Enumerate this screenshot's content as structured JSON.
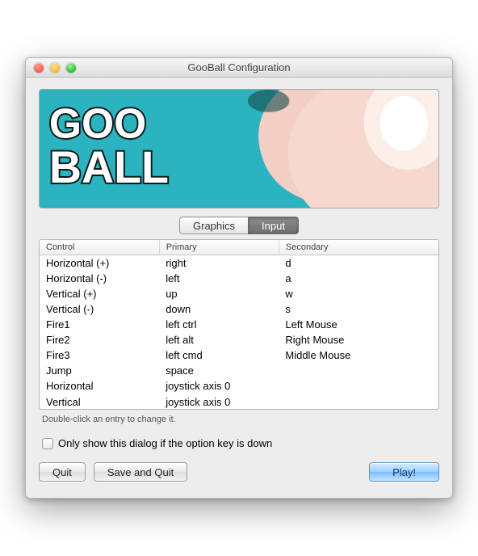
{
  "window": {
    "title": "GooBall Configuration"
  },
  "banner": {
    "logo_text": "GOO BALL"
  },
  "tabs": {
    "graphics": "Graphics",
    "input": "Input",
    "active": "input"
  },
  "table": {
    "headers": {
      "control": "Control",
      "primary": "Primary",
      "secondary": "Secondary"
    },
    "rows": [
      {
        "control": "Horizontal (+)",
        "primary": "right",
        "secondary": "d"
      },
      {
        "control": "Horizontal (-)",
        "primary": "left",
        "secondary": "a"
      },
      {
        "control": "Vertical (+)",
        "primary": "up",
        "secondary": "w"
      },
      {
        "control": "Vertical (-)",
        "primary": "down",
        "secondary": "s"
      },
      {
        "control": "Fire1",
        "primary": "left ctrl",
        "secondary": "Left Mouse"
      },
      {
        "control": "Fire2",
        "primary": "left alt",
        "secondary": "Right Mouse"
      },
      {
        "control": "Fire3",
        "primary": "left cmd",
        "secondary": "Middle Mouse"
      },
      {
        "control": "Jump",
        "primary": "space",
        "secondary": ""
      },
      {
        "control": "Horizontal",
        "primary": "joystick axis 0",
        "secondary": ""
      },
      {
        "control": "Vertical",
        "primary": "joystick axis 0",
        "secondary": ""
      }
    ],
    "hint": "Double-click an entry to change it."
  },
  "checkbox": {
    "label": "Only show this dialog if the option key is down",
    "checked": false
  },
  "buttons": {
    "quit": "Quit",
    "save_quit": "Save and Quit",
    "play": "Play!"
  },
  "columns_pct": [
    30,
    30,
    40
  ]
}
